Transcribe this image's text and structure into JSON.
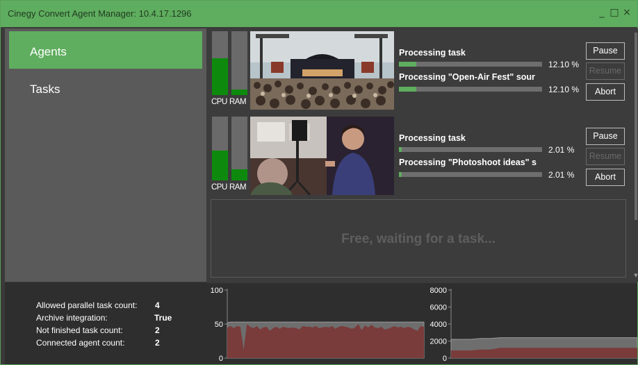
{
  "window": {
    "title": "Cinegy Convert Agent Manager: 10.4.17.1296",
    "minimize_glyph": "_",
    "maximize_glyph": "□",
    "close_glyph": "×"
  },
  "sidebar": {
    "items": [
      {
        "label": "Agents",
        "active": true
      },
      {
        "label": "Tasks",
        "active": false
      }
    ]
  },
  "agents": [
    {
      "cpu_label": "CPU",
      "ram_label": "RAM",
      "cpu_level": 0.58,
      "ram_level": 0.09,
      "thumbnail": "concert-crowd",
      "task_title": "Processing task",
      "task_progress_text": "12.10 %",
      "task_progress": 0.121,
      "sub_title": "Processing \"Open-Air Fest\" sour",
      "sub_progress_text": "12.10 %",
      "sub_progress": 0.121,
      "pause_label": "Pause",
      "resume_label": "Resume",
      "abort_label": "Abort"
    },
    {
      "cpu_label": "CPU",
      "ram_label": "RAM",
      "cpu_level": 0.47,
      "ram_level": 0.17,
      "thumbnail": "photoshoot",
      "task_title": "Processing task",
      "task_progress_text": "2.01 %",
      "task_progress": 0.0201,
      "sub_title": "Processing \"Photoshoot ideas\" s",
      "sub_progress_text": "2.01 %",
      "sub_progress": 0.0201,
      "pause_label": "Pause",
      "resume_label": "Resume",
      "abort_label": "Abort"
    }
  ],
  "free_slot": {
    "label": "Free, waiting for a task..."
  },
  "stats": [
    {
      "label": "Allowed parallel task count:",
      "value": "4"
    },
    {
      "label": "Archive integration:",
      "value": "True"
    },
    {
      "label": "Not finished task count:",
      "value": "2"
    },
    {
      "label": "Connected agent count:",
      "value": "2"
    }
  ],
  "chart_data": [
    {
      "type": "area",
      "yticks": [
        "100",
        "50",
        "0"
      ],
      "ylim": [
        0,
        100
      ],
      "series": [
        {
          "color": "#6e6e6e",
          "values": [
            52,
            53,
            53,
            53,
            53,
            53,
            53,
            53,
            53,
            53,
            53,
            53,
            53,
            53,
            53,
            53,
            53,
            53,
            53,
            53,
            53,
            53,
            53,
            53,
            53,
            53,
            53,
            53,
            53,
            53,
            53,
            53,
            53,
            53,
            53,
            53,
            53,
            53,
            53,
            53,
            53,
            53,
            53,
            53,
            53,
            53,
            53,
            53,
            53,
            53,
            53,
            53,
            53,
            53,
            53,
            53,
            53,
            53,
            53,
            53,
            53
          ]
        },
        {
          "color": "#7a3b3b",
          "values": [
            45,
            47,
            44,
            47,
            46,
            12,
            50,
            46,
            44,
            47,
            42,
            45,
            46,
            40,
            44,
            46,
            43,
            46,
            45,
            44,
            45,
            44,
            42,
            47,
            46,
            46,
            45,
            47,
            44,
            45,
            46,
            45,
            47,
            43,
            46,
            47,
            46,
            45,
            43,
            45,
            50,
            41,
            48,
            45,
            49,
            45,
            44,
            46,
            42,
            43,
            45,
            47,
            45,
            46,
            44,
            46,
            45,
            42,
            40,
            47,
            46
          ]
        }
      ]
    },
    {
      "type": "area",
      "yticks": [
        "8000",
        "6000",
        "4000",
        "2000",
        "0"
      ],
      "ylim": [
        0,
        8000
      ],
      "series": [
        {
          "color": "#6e6e6e",
          "values": [
            2200,
            2200,
            2200,
            2300,
            2300,
            2400,
            2400,
            2400,
            2400,
            2400,
            2400,
            2400,
            2400,
            2400,
            2400,
            2400,
            2400,
            2400,
            2400,
            2400
          ]
        },
        {
          "color": "#7a3b3b",
          "values": [
            900,
            900,
            900,
            1000,
            1000,
            1200,
            1200,
            1200,
            1200,
            1200,
            1200,
            1200,
            1200,
            1200,
            1200,
            1200,
            1200,
            1200,
            1200,
            1200
          ]
        }
      ]
    }
  ]
}
